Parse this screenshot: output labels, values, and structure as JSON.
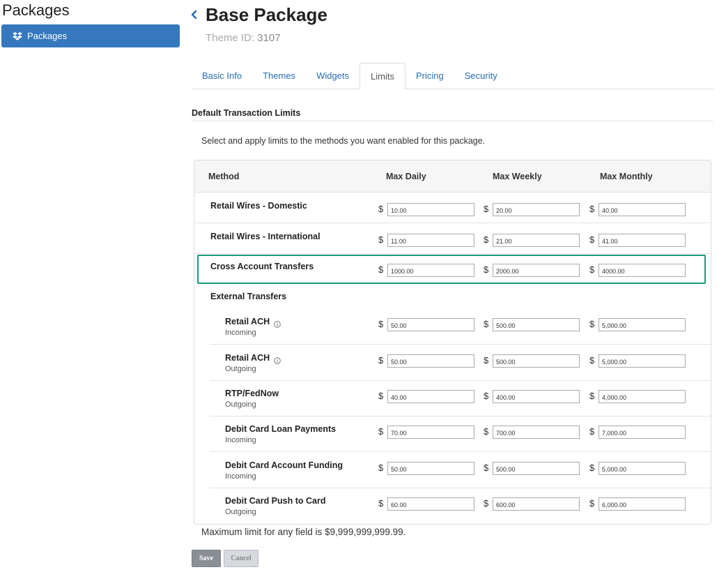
{
  "sidebar": {
    "title": "Packages",
    "items": [
      {
        "label": "Packages",
        "icon": "dropbox-icon"
      }
    ]
  },
  "header": {
    "title": "Base Package",
    "theme_label": "Theme ID:",
    "theme_id": "3107"
  },
  "tabs": [
    {
      "label": "Basic Info",
      "active": false
    },
    {
      "label": "Themes",
      "active": false
    },
    {
      "label": "Widgets",
      "active": false
    },
    {
      "label": "Limits",
      "active": true
    },
    {
      "label": "Pricing",
      "active": false
    },
    {
      "label": "Security",
      "active": false
    }
  ],
  "section": {
    "title": "Default Transaction Limits",
    "description": "Select and apply limits to the methods you want enabled for this package."
  },
  "table": {
    "headers": [
      "Method",
      "Max Daily",
      "Max Weekly",
      "Max Monthly"
    ],
    "currency": "$",
    "rows": [
      {
        "label": "Retail Wires - Domestic",
        "daily": "10.00",
        "weekly": "20.00",
        "monthly": "40.00"
      },
      {
        "label": "Retail Wires - International",
        "daily": "11.00",
        "weekly": "21.00",
        "monthly": "41.00"
      },
      {
        "label": "Cross Account Transfers",
        "daily": "1000.00",
        "weekly": "2000.00",
        "monthly": "4000.00"
      }
    ],
    "group_label": "External Transfers",
    "sub_rows": [
      {
        "label": "Retail ACH",
        "sub": "Incoming",
        "info": true,
        "daily": "50.00",
        "weekly": "500.00",
        "monthly": "5,000.00"
      },
      {
        "label": "Retail ACH",
        "sub": "Outgoing",
        "info": true,
        "daily": "50.00",
        "weekly": "500.00",
        "monthly": "5,000.00"
      },
      {
        "label": "RTP/FedNow",
        "sub": "Outgoing",
        "info": false,
        "daily": "40.00",
        "weekly": "400.00",
        "monthly": "4,000.00"
      },
      {
        "label": "Debit Card Loan Payments",
        "sub": "Incoming",
        "info": false,
        "daily": "70.00",
        "weekly": "700.00",
        "monthly": "7,000.00"
      },
      {
        "label": "Debit Card Account Funding",
        "sub": "Incoming",
        "info": false,
        "daily": "50.00",
        "weekly": "500.00",
        "monthly": "5,000.00"
      },
      {
        "label": "Debit Card Push to Card",
        "sub": "Outgoing",
        "info": false,
        "daily": "60.00",
        "weekly": "600.00",
        "monthly": "6,000.00"
      }
    ]
  },
  "footer": {
    "max_note": "Maximum limit for any field is $9,999,999,999.99.",
    "save_label": "Save",
    "cancel_label": "Cancel"
  },
  "colors": {
    "accent": "#3578bd",
    "link": "#2a6db3",
    "highlight": "#1a9a7a"
  }
}
